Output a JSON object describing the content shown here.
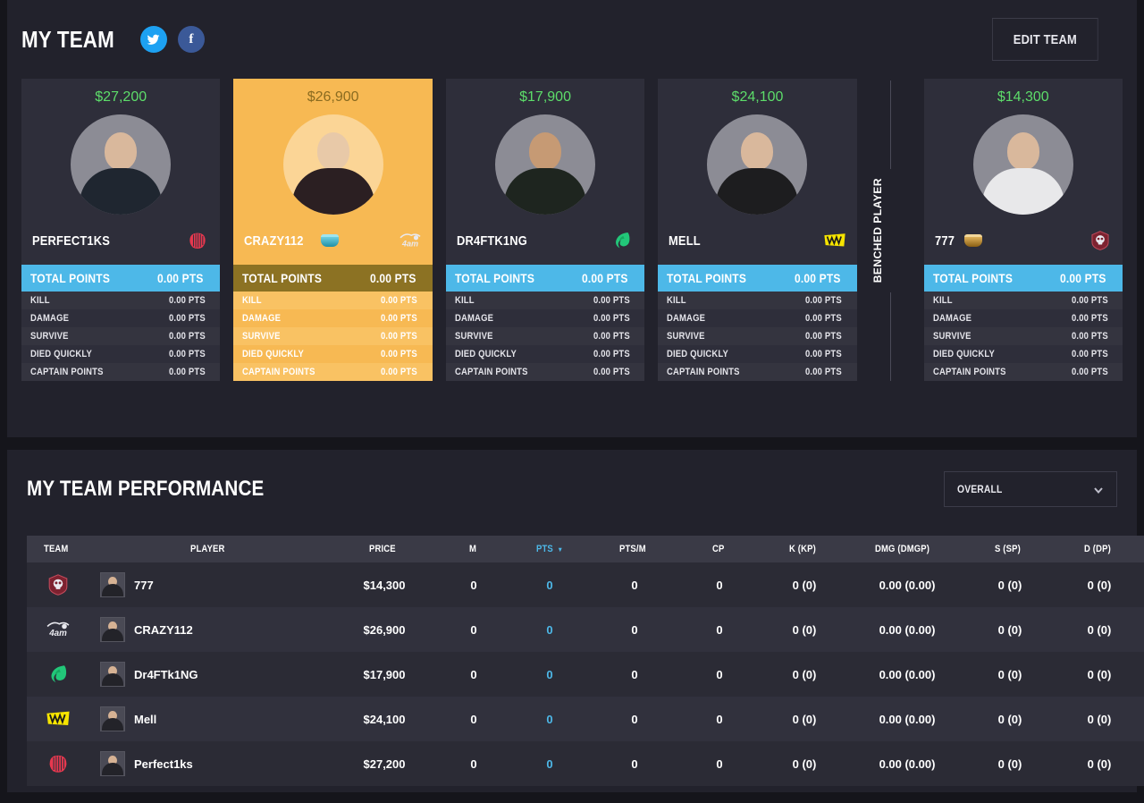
{
  "header": {
    "title": "MY TEAM",
    "social": [
      {
        "name": "twitter",
        "label": "t"
      },
      {
        "name": "facebook",
        "label": "f"
      }
    ],
    "edit_button": "EDIT TEAM"
  },
  "bench_divider_label": "BENCHED PLAYER",
  "stat_labels": {
    "total": "TOTAL POINTS",
    "kill": "KILL",
    "damage": "DAMAGE",
    "survive": "SURVIVE",
    "died_quickly": "DIED QUICKLY",
    "captain_points": "CAPTAIN POINTS"
  },
  "cards": [
    {
      "name": "PERFECT1KS",
      "price": "$27,200",
      "team_logo": "brain-logo",
      "badge": null,
      "highlighted": false,
      "benched": false,
      "total_points": "0.00 PTS",
      "stats": [
        {
          "label": "KILL",
          "value": "0.00 PTS"
        },
        {
          "label": "DAMAGE",
          "value": "0.00 PTS"
        },
        {
          "label": "SURVIVE",
          "value": "0.00 PTS"
        },
        {
          "label": "DIED QUICKLY",
          "value": "0.00 PTS"
        },
        {
          "label": "CAPTAIN POINTS",
          "value": "0.00 PTS"
        }
      ]
    },
    {
      "name": "CRAZY112",
      "price": "$26,900",
      "team_logo": "4am-logo",
      "badge": "captain-badge",
      "highlighted": true,
      "benched": false,
      "total_points": "0.00 PTS",
      "stats": [
        {
          "label": "KILL",
          "value": "0.00 PTS"
        },
        {
          "label": "DAMAGE",
          "value": "0.00 PTS"
        },
        {
          "label": "SURVIVE",
          "value": "0.00 PTS"
        },
        {
          "label": "DIED QUICKLY",
          "value": "0.00 PTS"
        },
        {
          "label": "CAPTAIN POINTS",
          "value": "0.00 PTS"
        }
      ]
    },
    {
      "name": "DR4FTK1NG",
      "price": "$17,900",
      "team_logo": "phoenix-logo",
      "badge": null,
      "highlighted": false,
      "benched": false,
      "total_points": "0.00 PTS",
      "stats": [
        {
          "label": "KILL",
          "value": "0.00 PTS"
        },
        {
          "label": "DAMAGE",
          "value": "0.00 PTS"
        },
        {
          "label": "SURVIVE",
          "value": "0.00 PTS"
        },
        {
          "label": "DIED QUICKLY",
          "value": "0.00 PTS"
        },
        {
          "label": "CAPTAIN POINTS",
          "value": "0.00 PTS"
        }
      ]
    },
    {
      "name": "MELL",
      "price": "$24,100",
      "team_logo": "navi-logo",
      "badge": null,
      "highlighted": false,
      "benched": false,
      "total_points": "0.00 PTS",
      "stats": [
        {
          "label": "KILL",
          "value": "0.00 PTS"
        },
        {
          "label": "DAMAGE",
          "value": "0.00 PTS"
        },
        {
          "label": "SURVIVE",
          "value": "0.00 PTS"
        },
        {
          "label": "DIED QUICKLY",
          "value": "0.00 PTS"
        },
        {
          "label": "CAPTAIN POINTS",
          "value": "0.00 PTS"
        }
      ]
    },
    {
      "name": "777",
      "price": "$14,300",
      "team_logo": "skull-logo",
      "badge": "bench-badge",
      "highlighted": false,
      "benched": true,
      "total_points": "0.00 PTS",
      "stats": [
        {
          "label": "KILL",
          "value": "0.00 PTS"
        },
        {
          "label": "DAMAGE",
          "value": "0.00 PTS"
        },
        {
          "label": "SURVIVE",
          "value": "0.00 PTS"
        },
        {
          "label": "DIED QUICKLY",
          "value": "0.00 PTS"
        },
        {
          "label": "CAPTAIN POINTS",
          "value": "0.00 PTS"
        }
      ]
    }
  ],
  "performance": {
    "title": "MY TEAM PERFORMANCE",
    "filter_value": "OVERALL",
    "filter_icon": "chevron-down-icon",
    "columns": [
      {
        "key": "team",
        "label": "TEAM",
        "sorted": false
      },
      {
        "key": "player",
        "label": "PLAYER",
        "sorted": false
      },
      {
        "key": "price",
        "label": "PRICE",
        "sorted": false
      },
      {
        "key": "m",
        "label": "M",
        "sorted": false
      },
      {
        "key": "pts",
        "label": "PTS",
        "sorted": true
      },
      {
        "key": "ptsm",
        "label": "PTS/M",
        "sorted": false
      },
      {
        "key": "cp",
        "label": "CP",
        "sorted": false
      },
      {
        "key": "k",
        "label": "K (KP)",
        "sorted": false
      },
      {
        "key": "dmg",
        "label": "DMG (DMGP)",
        "sorted": false
      },
      {
        "key": "s",
        "label": "S (SP)",
        "sorted": false
      },
      {
        "key": "d",
        "label": "D (DP)",
        "sorted": false
      }
    ],
    "sort_arrow": "▾",
    "rows": [
      {
        "team_logo": "skull-logo",
        "player": "777",
        "price": "$14,300",
        "m": "0",
        "pts": "0",
        "ptsm": "0",
        "cp": "0",
        "k": "0 (0)",
        "dmg": "0.00 (0.00)",
        "s": "0 (0)",
        "d": "0 (0)"
      },
      {
        "team_logo": "4am-logo",
        "player": "CRAZY112",
        "price": "$26,900",
        "m": "0",
        "pts": "0",
        "ptsm": "0",
        "cp": "0",
        "k": "0 (0)",
        "dmg": "0.00 (0.00)",
        "s": "0 (0)",
        "d": "0 (0)"
      },
      {
        "team_logo": "phoenix-logo",
        "player": "Dr4FTk1NG",
        "price": "$17,900",
        "m": "0",
        "pts": "0",
        "ptsm": "0",
        "cp": "0",
        "k": "0 (0)",
        "dmg": "0.00 (0.00)",
        "s": "0 (0)",
        "d": "0 (0)"
      },
      {
        "team_logo": "navi-logo",
        "player": "Mell",
        "price": "$24,100",
        "m": "0",
        "pts": "0",
        "ptsm": "0",
        "cp": "0",
        "k": "0 (0)",
        "dmg": "0.00 (0.00)",
        "s": "0 (0)",
        "d": "0 (0)"
      },
      {
        "team_logo": "brain-logo",
        "player": "Perfect1ks",
        "price": "$27,200",
        "m": "0",
        "pts": "0",
        "ptsm": "0",
        "cp": "0",
        "k": "0 (0)",
        "dmg": "0.00 (0.00)",
        "s": "0 (0)",
        "d": "0 (0)"
      }
    ]
  },
  "colors": {
    "page_bg": "#15151b",
    "panel_bg": "#22222c",
    "card_bg": "#2e2e3a",
    "captain_bg": "#f7b953",
    "accent_blue": "#4db8e8",
    "price_green": "#5ddd6a"
  }
}
